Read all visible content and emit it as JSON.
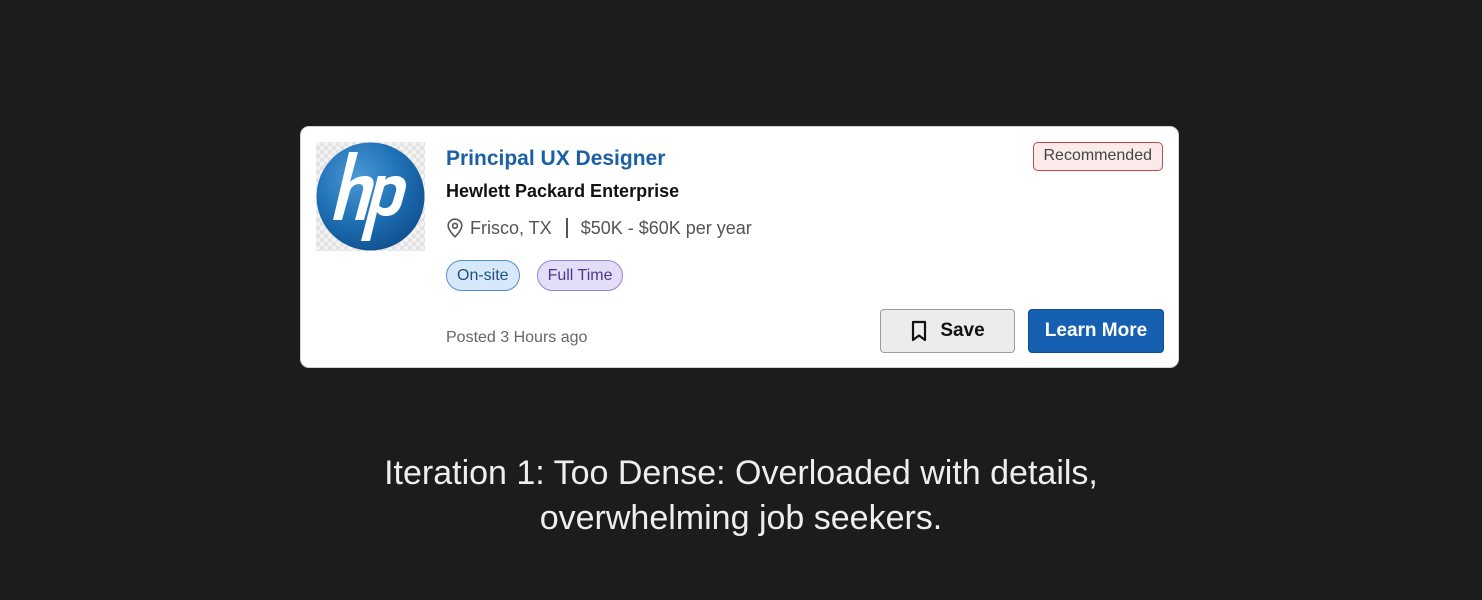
{
  "job_card": {
    "company_logo": {
      "icon": "hp-logo",
      "brand_color": "#1f6fb5",
      "logo_text": "hp"
    },
    "title": "Principal UX Designer",
    "company": "Hewlett Packard Enterprise",
    "location_icon": "map-pin-icon",
    "location": "Frisco, TX",
    "salary": "$50K - $60K per year",
    "tags": [
      {
        "label": "On-site",
        "color": "#d6e8fa"
      },
      {
        "label": "Full Time",
        "color": "#e3ddf7"
      }
    ],
    "badge": "Recommended",
    "posted": "Posted 3 Hours ago",
    "save_icon": "bookmark-icon",
    "save_label": "Save",
    "learn_more_label": "Learn More",
    "accent_color": "#1560b0"
  },
  "caption": {
    "line1": "Iteration 1: Too Dense: Overloaded with details,",
    "line2": "overwhelming job seekers."
  }
}
